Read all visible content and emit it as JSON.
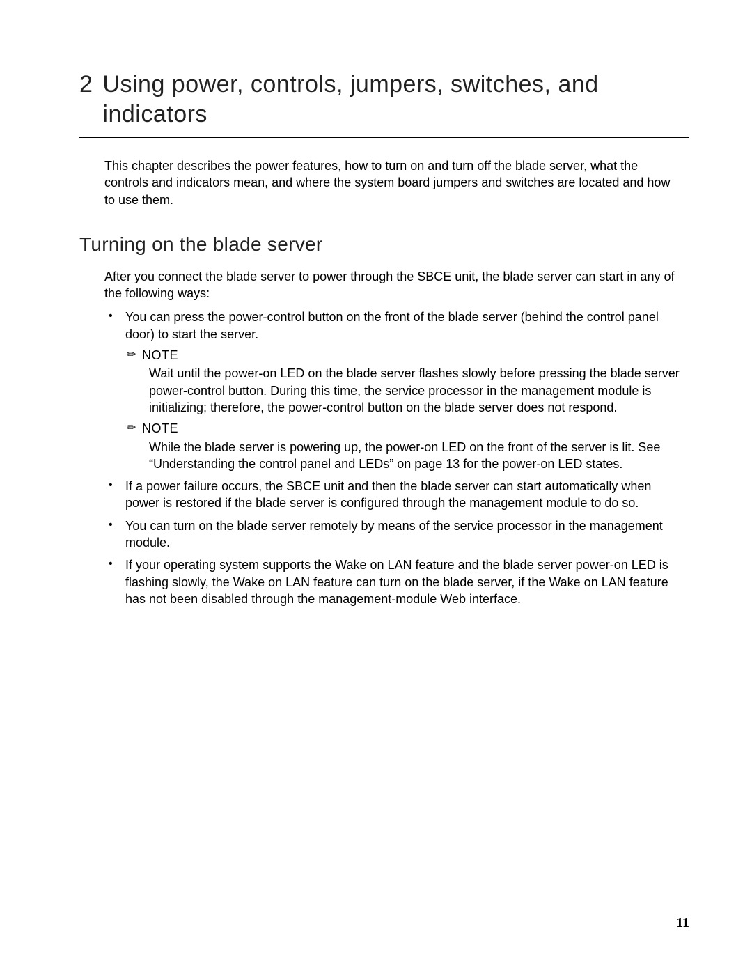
{
  "chapter": {
    "number": "2",
    "title": "Using power, controls, jumpers, switches, and indicators"
  },
  "intro": "This chapter describes the power features, how to turn on and turn off the blade server, what the controls and indicators mean, and where the system board jumpers and switches are located and how to use them.",
  "section": {
    "title": "Turning on the blade server",
    "intro": "After you connect the blade server to power through the SBCE unit, the blade server can start in any of the following ways:"
  },
  "bullets": {
    "b1": "You can press the power-control button on the front of the blade server (behind the control panel door) to start the server.",
    "b2": "If a power failure occurs, the SBCE unit and then the blade server can start automatically when power is restored if the blade server is configured through the management module to do so.",
    "b3": "You can turn on the blade server remotely by means of the service processor in the management module.",
    "b4": "If your operating system supports the Wake on LAN feature and the blade server power-on LED is flashing slowly, the Wake on LAN feature can turn on the blade server, if the Wake on LAN feature has not been disabled through the management-module Web interface."
  },
  "notes": {
    "label": "NOTE",
    "icon": "✏",
    "n1": "Wait until the power-on LED on the blade server flashes slowly before pressing the blade server power-control button. During this time, the service processor in the management module is initializing; therefore, the power-control button on the blade server does not respond.",
    "n2": "While the blade server is powering up, the power-on LED on the front of the server is lit. See “Understanding the control panel and LEDs” on page 13 for the power-on LED states."
  },
  "pageNumber": "11"
}
